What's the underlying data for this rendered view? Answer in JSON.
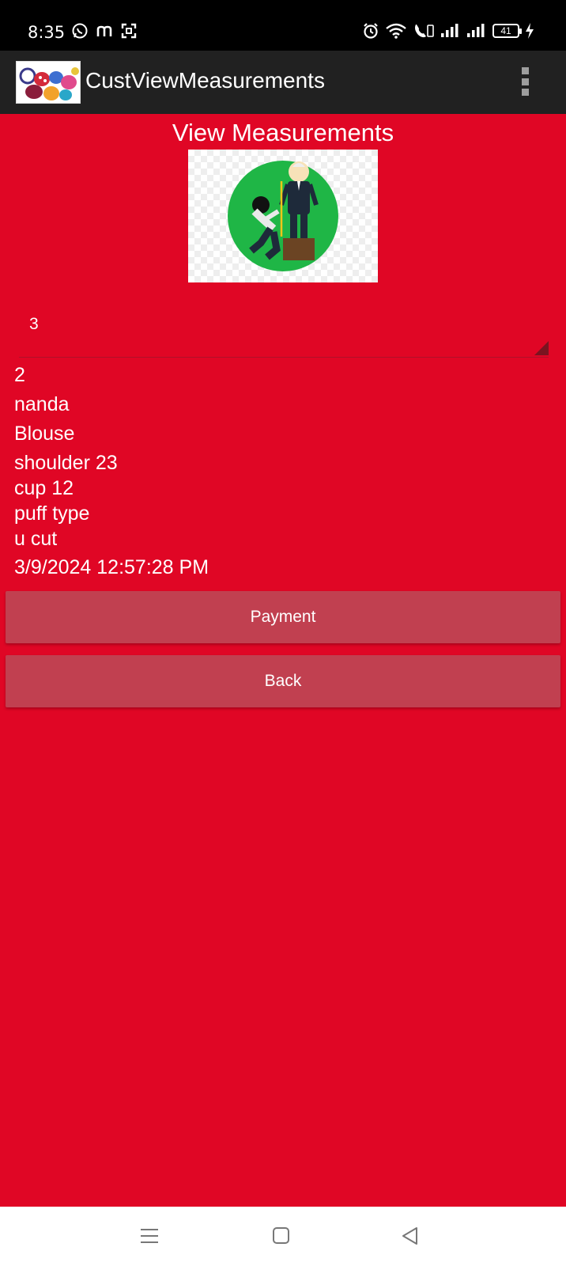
{
  "status_bar": {
    "time": "8:35",
    "left_icons": [
      "whatsapp-icon",
      "m-app-icon",
      "screenshot-icon"
    ],
    "right_icons": [
      "alarm-icon",
      "wifi-icon",
      "volte-icon",
      "signal-1-icon",
      "signal-2-icon"
    ],
    "battery": "41"
  },
  "action_bar": {
    "title": "CustViewMeasurements",
    "overflow_icon": "overflow-menu-icon"
  },
  "page": {
    "title": "View Measurements",
    "spinner_value": "3",
    "details": {
      "id": "2",
      "name": "nanda",
      "garment": "Blouse",
      "line1": "shoulder 23",
      "line2": "cup 12",
      "line3": "puff type",
      "line4": "u cut",
      "datetime": "3/9/2024 12:57:28 PM"
    },
    "buttons": {
      "payment": "Payment",
      "back": "Back"
    }
  },
  "colors": {
    "background": "#e00625",
    "button": "#c14050",
    "action_bar": "#212121",
    "status_bar": "#000000"
  },
  "nav_bar": {
    "icons": [
      "recents-icon",
      "home-icon",
      "back-icon"
    ]
  }
}
